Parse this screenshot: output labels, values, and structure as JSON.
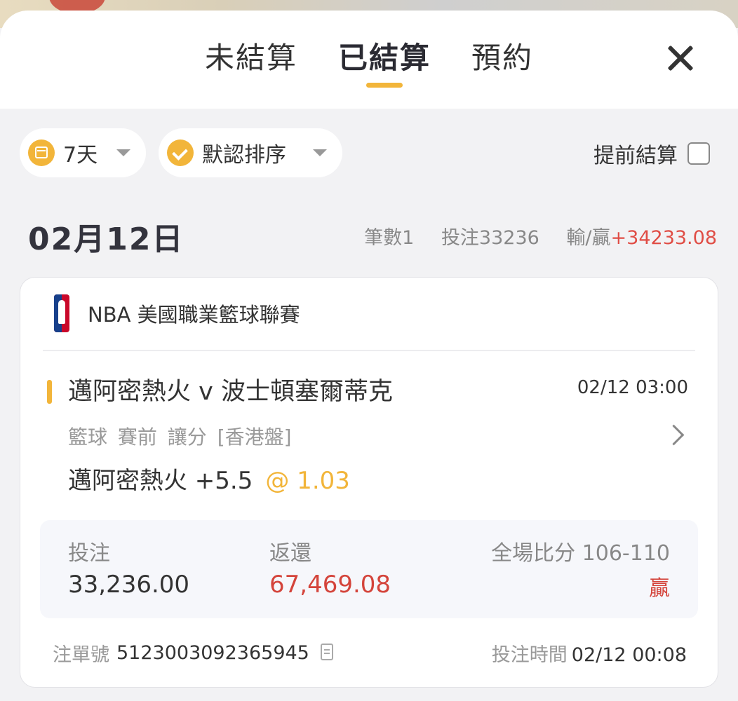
{
  "tabs": [
    {
      "label": "未結算",
      "active": false
    },
    {
      "label": "已結算",
      "active": true
    },
    {
      "label": "預約",
      "active": false
    }
  ],
  "filters": {
    "days_label": "7天",
    "sort_label": "默認排序",
    "early_settle_label": "提前結算",
    "early_settle_checked": false
  },
  "date_group": {
    "date": "02月12日",
    "count_text": "筆數1",
    "stake_text": "投注33236",
    "pl_label": "輸/贏",
    "pl_value": "+34233.08"
  },
  "bet": {
    "league": "NBA 美國職業籃球聯賽",
    "match": "邁阿密熱火 v 波士頓塞爾蒂克",
    "match_time": "02/12 03:00",
    "market": "籃球 賽前 讓分 [香港盤]",
    "selection": "邁阿密熱火 +5.5",
    "odds": "@ 1.03",
    "stake_label": "投注",
    "stake_value": "33,236.00",
    "return_label": "返還",
    "return_value": "67,469.08",
    "score_label": "全場比分",
    "score_value": "106-110",
    "result": "贏",
    "ticket_label": "注單號",
    "ticket_number": "5123003092365945",
    "bet_time_label": "投注時間",
    "bet_time_value": "02/12 00:08"
  },
  "colors": {
    "accent": "#f2b53a",
    "win": "#d4443b",
    "muted": "#999999"
  },
  "icons": {
    "close": "close-icon",
    "calendar": "calendar-icon",
    "check": "check-circle-icon",
    "league": "nba-logo-icon",
    "chevron": "chevron-right-icon",
    "copy": "copy-icon"
  }
}
